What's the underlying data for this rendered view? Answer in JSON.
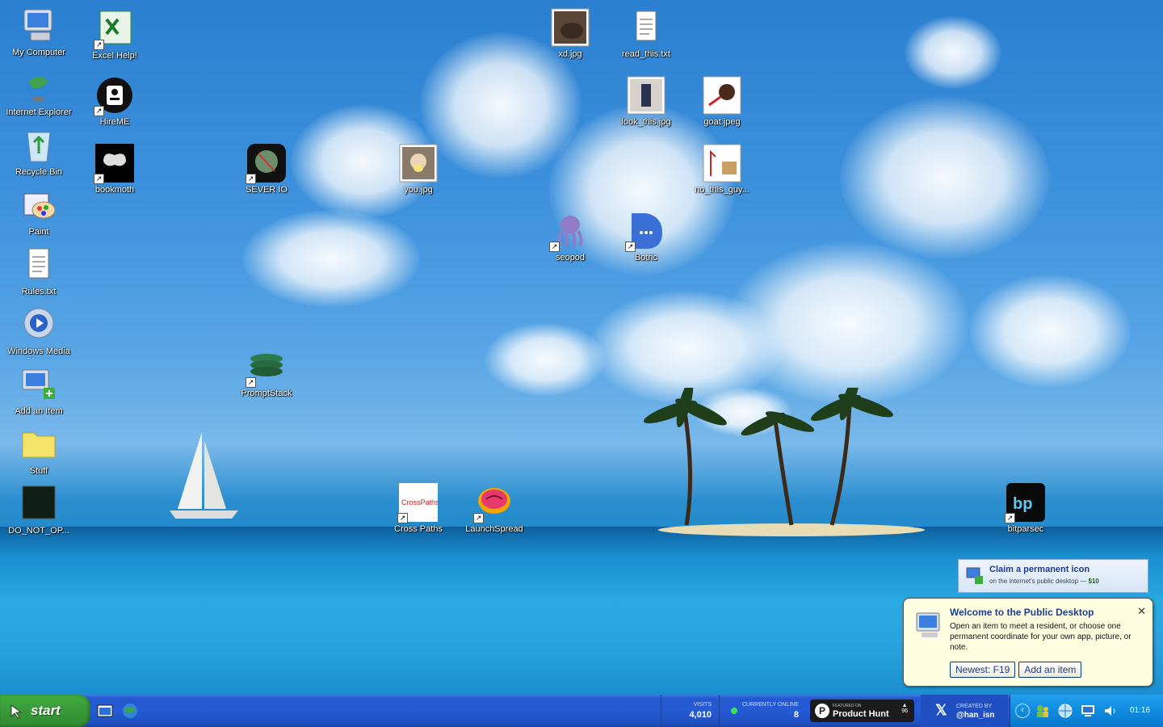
{
  "desktop": {
    "icons": [
      {
        "label": "My Computer",
        "icon": "my-computer-icon"
      },
      {
        "label": "Internet Explorer",
        "icon": "internet-explorer-icon"
      },
      {
        "label": "Recycle Bin",
        "icon": "recycle-bin-icon"
      },
      {
        "label": "Paint",
        "icon": "paint-icon"
      },
      {
        "label": "Rules.txt",
        "icon": "text-file-icon"
      },
      {
        "label": "Windows Media Player",
        "icon": "media-player-icon"
      },
      {
        "label": "Add an Item",
        "icon": "add-item-icon"
      },
      {
        "label": "Stuff",
        "icon": "folder-icon"
      },
      {
        "label": "DO_NOT_OP...",
        "icon": "dark-app-icon"
      },
      {
        "label": "Excel Help!",
        "icon": "excel-icon"
      },
      {
        "label": "HireME",
        "icon": "hireme-icon"
      },
      {
        "label": "bookmoth",
        "icon": "bookmoth-icon"
      },
      {
        "label": "SEVER IO",
        "icon": "sever-io-icon"
      },
      {
        "label": "PromptStack",
        "icon": "promptstack-icon"
      },
      {
        "label": "you.jpg",
        "icon": "image-thumbnail-icon"
      },
      {
        "label": "Cross Paths",
        "icon": "cross-paths-icon"
      },
      {
        "label": "LaunchSpread",
        "icon": "launchspread-icon"
      },
      {
        "label": "xd.jpg",
        "icon": "image-thumbnail-icon"
      },
      {
        "label": "read_this.txt",
        "icon": "text-file-icon"
      },
      {
        "label": "look_this.jpg",
        "icon": "image-thumbnail-icon"
      },
      {
        "label": "goat.jpeg",
        "icon": "image-thumbnail-icon"
      },
      {
        "label": "no_this_guy...",
        "icon": "image-thumbnail-icon"
      },
      {
        "label": "seopod",
        "icon": "seopod-octopus-icon"
      },
      {
        "label": "Botric",
        "icon": "botric-chat-icon"
      },
      {
        "label": "bitparsec",
        "icon": "bitparsec-icon"
      }
    ]
  },
  "claim": {
    "title": "Claim a permanent icon",
    "subtitle": "on the internet's public desktop — ",
    "price": "$10"
  },
  "balloon": {
    "title": "Welcome to the Public Desktop",
    "body": "Open an item to meet a resident, or choose one permanent coordinate for your own app, picture, or note.",
    "buttons": [
      "Newest: F19",
      "Add an item"
    ],
    "close": "✕"
  },
  "taskbar": {
    "start_label": "start",
    "visits_label": "VISITS",
    "visits_value": "4,010",
    "online_label": "CURRENTLY ONLINE",
    "online_value": "8",
    "producthunt_small": "FEATURED ON",
    "producthunt_label": "Product Hunt",
    "producthunt_votes": "96",
    "created_small": "CREATED BY",
    "created_handle": "@han_isn",
    "clock": "01:16"
  },
  "colors": {
    "taskbar_blue": "#245ad4",
    "start_green": "#3a9d3a",
    "balloon_yellow": "#fffee1",
    "tray_blue": "#0f8be0"
  }
}
